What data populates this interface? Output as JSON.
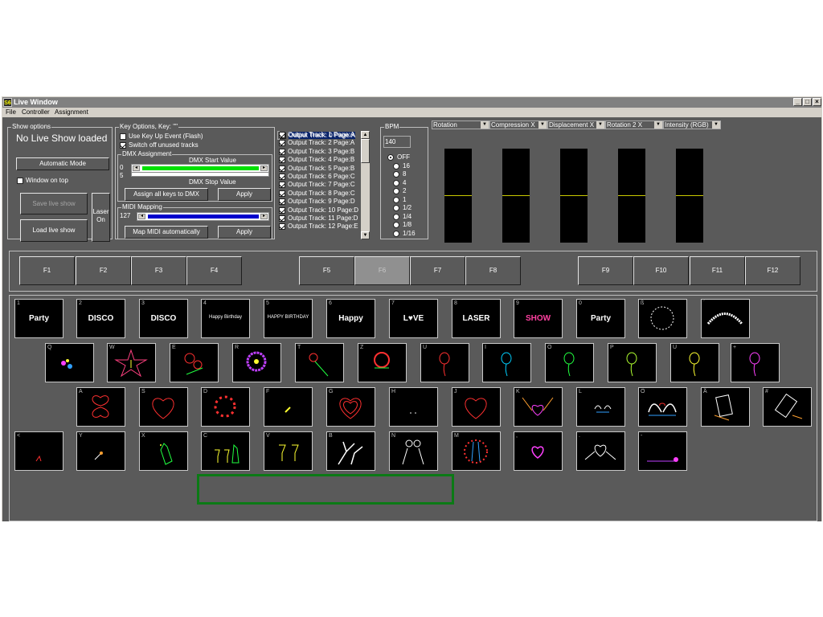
{
  "window": {
    "icon_label": "S6",
    "title": "Live Window",
    "controls": {
      "minimize": "_",
      "maximize": "□",
      "close": "×"
    }
  },
  "menu": [
    "File",
    "Controller",
    "Assignment"
  ],
  "show_options": {
    "legend": "Show options",
    "status": "No Live Show loaded",
    "automatic_mode": "Automatic Mode",
    "window_on_top": "Window on top",
    "window_on_top_checked": false,
    "save": "Save live show",
    "laser": "Laser On",
    "load": "Load live show"
  },
  "key_options": {
    "legend": "Key Options, Key: \"\"",
    "use_key_up": "Use Key Up Event (Flash)",
    "use_key_up_checked": false,
    "switch_off": "Switch off unused tracks",
    "switch_off_checked": true,
    "dmx": {
      "legend": "DMX Assignment",
      "start_label": "DMX Start Value",
      "stop_label": "DMX Stop Value",
      "start_value": "0",
      "stop_value": "5",
      "start_fill": "#00e000",
      "assign_all": "Assign all keys to DMX",
      "apply": "Apply"
    },
    "midi": {
      "legend": "MIDI Mapping",
      "value": "127",
      "fill": "#0000cc",
      "map_auto": "Map MIDI automatically",
      "apply": "Apply"
    }
  },
  "tracks": [
    {
      "label": "Output Track: 0 Page:A",
      "checked": true,
      "selected": true
    },
    {
      "label": "Output Track: 1 Page:A",
      "checked": true
    },
    {
      "label": "Output Track: 2 Page:A",
      "checked": true
    },
    {
      "label": "Output Track: 3 Page:B",
      "checked": true
    },
    {
      "label": "Output Track: 4 Page:B",
      "checked": true
    },
    {
      "label": "Output Track: 5 Page:B",
      "checked": true
    },
    {
      "label": "Output Track: 6 Page:C",
      "checked": true
    },
    {
      "label": "Output Track: 7 Page:C",
      "checked": true
    },
    {
      "label": "Output Track: 8 Page:C",
      "checked": true
    },
    {
      "label": "Output Track: 9 Page:D",
      "checked": true
    },
    {
      "label": "Output Track: 10 Page:D",
      "checked": true
    },
    {
      "label": "Output Track: 11 Page:D",
      "checked": true
    },
    {
      "label": "Output Track: 12 Page:E",
      "checked": true
    }
  ],
  "bpm": {
    "legend": "BPM",
    "value": "140",
    "options": [
      "OFF",
      "16",
      "8",
      "4",
      "2",
      "1",
      "1/2",
      "1/4",
      "1/8",
      "1/16"
    ],
    "selected": "OFF"
  },
  "effects": [
    "Rotation",
    "Compression X",
    "Displacement X",
    "Rotation 2 X",
    "Intensity (RGB)"
  ],
  "fkeys": [
    "F1",
    "F2",
    "F3",
    "F4",
    "F5",
    "F6",
    "F7",
    "F8",
    "F9",
    "F10",
    "F11",
    "F12"
  ],
  "active_fkey": "F6",
  "keys": {
    "row1": [
      {
        "key": "1",
        "text": "Party"
      },
      {
        "key": "2",
        "text": "DISCO"
      },
      {
        "key": "3",
        "text": "DISCO"
      },
      {
        "key": "4",
        "small": "Happy Birthday"
      },
      {
        "key": "5",
        "small": "HAPPY BIRTHDAY"
      },
      {
        "key": "6",
        "text": "Happy"
      },
      {
        "key": "7",
        "text": "L♥VE"
      },
      {
        "key": "8",
        "text": "LASER"
      },
      {
        "key": "9",
        "text": "SHOW"
      },
      {
        "key": "0",
        "text": "Party"
      },
      {
        "key": "ß",
        "icon": "circular-text"
      },
      {
        "key": "´",
        "icon": "arc-text"
      }
    ],
    "row2": [
      {
        "key": "Q",
        "icon": "flowers"
      },
      {
        "key": "W",
        "icon": "lily"
      },
      {
        "key": "E",
        "icon": "roses"
      },
      {
        "key": "R",
        "icon": "aster"
      },
      {
        "key": "T",
        "icon": "rose-stem"
      },
      {
        "key": "Z",
        "icon": "rose"
      },
      {
        "key": "U",
        "icon": "balloon-red"
      },
      {
        "key": "I",
        "icon": "balloon-cyan"
      },
      {
        "key": "O",
        "icon": "balloon-green"
      },
      {
        "key": "P",
        "icon": "balloon-lime"
      },
      {
        "key": "Ü",
        "icon": "balloon-yellow"
      },
      {
        "key": "+",
        "icon": "balloon-magenta"
      }
    ],
    "row3": [
      {
        "key": "A",
        "icon": "heart-clover"
      },
      {
        "key": "S",
        "icon": "heart-outline"
      },
      {
        "key": "D",
        "icon": "heart-ring"
      },
      {
        "key": "F",
        "icon": "spark"
      },
      {
        "key": "G",
        "icon": "heart-nested"
      },
      {
        "key": "H",
        "icon": "dots"
      },
      {
        "key": "J",
        "icon": "heart-outline"
      },
      {
        "key": "K",
        "icon": "heart-hands"
      },
      {
        "key": "L",
        "icon": "swans-small"
      },
      {
        "key": "Ö",
        "icon": "swans"
      },
      {
        "key": "Ä",
        "icon": "phone-hand"
      },
      {
        "key": "#",
        "icon": "phone-tilt"
      }
    ],
    "row4": [
      {
        "key": "<",
        "icon": "tiny-red"
      },
      {
        "key": "Y",
        "icon": "match"
      },
      {
        "key": "X",
        "icon": "bottle"
      },
      {
        "key": "C",
        "icon": "champagne"
      },
      {
        "key": "V",
        "icon": "toast"
      },
      {
        "key": "B",
        "icon": "dancers"
      },
      {
        "key": "N",
        "icon": "couple"
      },
      {
        "key": "M",
        "icon": "kiss"
      },
      {
        "key": ",",
        "icon": "heart-purple"
      },
      {
        "key": ".",
        "icon": "heart-hands-white"
      },
      {
        "key": "-",
        "icon": "rose-line"
      }
    ]
  },
  "colors": {
    "bg": "#5a5a5a",
    "selected": "#0a246a",
    "green_frame": "#0b7a15",
    "meter_line": "#c9c900"
  }
}
